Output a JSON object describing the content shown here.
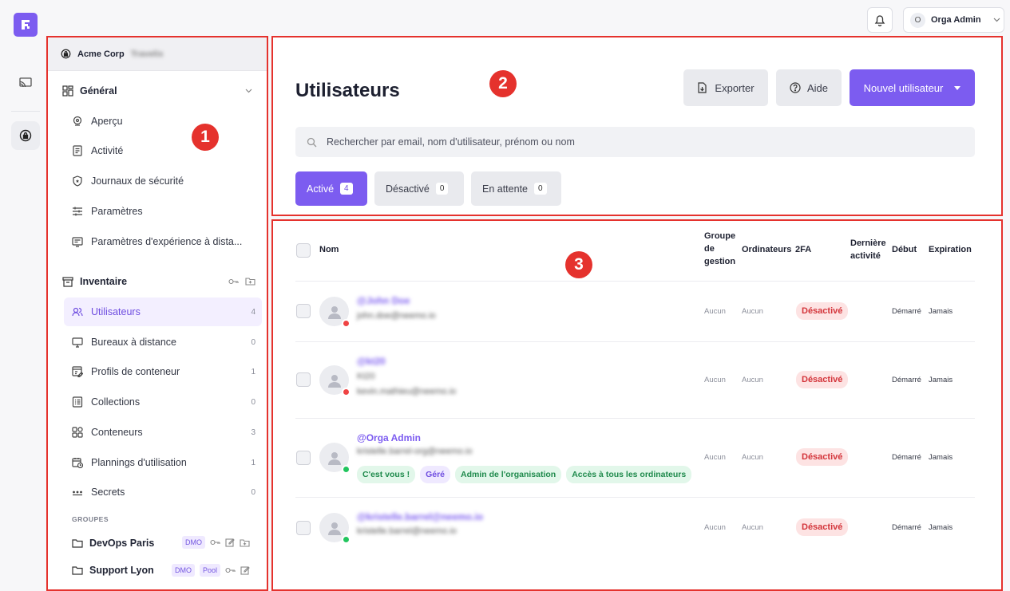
{
  "colors": {
    "accent": "#7c5cf0",
    "danger": "#e5322d",
    "online": "#22c55e",
    "offline": "#ef4444"
  },
  "topbar": {
    "account_initial": "O",
    "account_name": "Orga Admin"
  },
  "sidebar": {
    "org_name": "Acme Corp",
    "org_sub": "Travelix",
    "general": {
      "label": "Général",
      "items": [
        {
          "label": "Aperçu",
          "icon": "overview-icon"
        },
        {
          "label": "Activité",
          "icon": "activity-icon"
        },
        {
          "label": "Journaux de sécurité",
          "icon": "shield-icon"
        },
        {
          "label": "Paramètres",
          "icon": "sliders-icon"
        },
        {
          "label": "Paramètres d'expérience à dista...",
          "icon": "remote-experience-icon"
        }
      ]
    },
    "inventory": {
      "label": "Inventaire",
      "items": [
        {
          "label": "Utilisateurs",
          "count": "4"
        },
        {
          "label": "Bureaux à distance",
          "count": "0"
        },
        {
          "label": "Profils de conteneur",
          "count": "1"
        },
        {
          "label": "Collections",
          "count": "0"
        },
        {
          "label": "Conteneurs",
          "count": "3"
        },
        {
          "label": "Plannings d'utilisation",
          "count": "1"
        },
        {
          "label": "Secrets",
          "count": "0"
        }
      ]
    },
    "groups_label": "GROUPES",
    "groups": [
      {
        "name": "DevOps Paris",
        "tags": [
          "DMO"
        ]
      },
      {
        "name": "Support Lyon",
        "tags": [
          "DMO",
          "Pool"
        ]
      }
    ]
  },
  "callouts": [
    "1",
    "2",
    "3"
  ],
  "header": {
    "title": "Utilisateurs",
    "export_label": "Exporter",
    "help_label": "Aide",
    "new_user_label": "Nouvel utilisateur",
    "search_placeholder": "Rechercher par email, nom d'utilisateur, prénom ou nom",
    "tabs": [
      {
        "label": "Activé",
        "count": "4"
      },
      {
        "label": "Désactivé",
        "count": "0"
      },
      {
        "label": "En attente",
        "count": "0"
      }
    ]
  },
  "table": {
    "columns": {
      "name": "Nom",
      "group_l1": "Groupe",
      "group_l2": "de",
      "group_l3": "gestion",
      "computers": "Ordinateurs",
      "twofa": "2FA",
      "last_l1": "Dernière",
      "last_l2": "activité",
      "start": "Début",
      "expiry": "Expiration"
    },
    "rows": [
      {
        "username": "@John Doe",
        "line1": "john.doe@neemo.io",
        "line2": "",
        "group": "Aucun",
        "computers": "Aucun",
        "twofa": "Désactivé",
        "start": "Démarré",
        "expiry": "Jamais",
        "status": "offline"
      },
      {
        "username": "@kt20",
        "line1": "Kt20",
        "line2": "kevin.mathieu@neemo.io",
        "group": "Aucun",
        "computers": "Aucun",
        "twofa": "Désactivé",
        "start": "Démarré",
        "expiry": "Jamais",
        "status": "offline"
      },
      {
        "username": "@Orga Admin",
        "line1": "kristelle.barrel-org@neemo.io",
        "line2": "",
        "group": "Aucun",
        "computers": "Aucun",
        "twofa": "Désactivé",
        "start": "Démarré",
        "expiry": "Jamais",
        "status": "online",
        "chips": [
          "C'est vous !",
          "Géré",
          "Admin de l'organisation",
          "Accès à tous les ordinateurs"
        ]
      },
      {
        "username": "@kristelle.barrel@neemo.io",
        "line1": "kristelle.barrel@neemo.io",
        "line2": "",
        "group": "Aucun",
        "computers": "Aucun",
        "twofa": "Désactivé",
        "start": "Démarré",
        "expiry": "Jamais",
        "status": "online"
      }
    ]
  }
}
